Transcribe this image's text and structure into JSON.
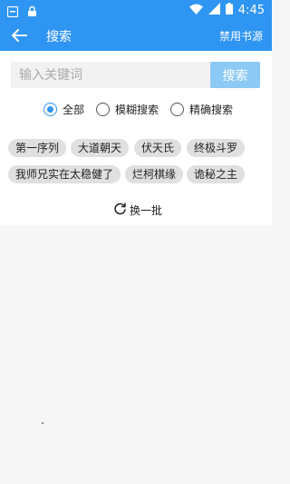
{
  "status_bar": {
    "time": "4:45",
    "icons": [
      "notification-icon",
      "lock-icon",
      "wifi-icon",
      "signal-icon",
      "battery-icon"
    ]
  },
  "app_bar": {
    "title": "搜索",
    "ban_label": "禁用书源",
    "back_icon": "back-arrow-icon"
  },
  "search": {
    "placeholder": "输入关键词",
    "value": "",
    "button_label": "搜索"
  },
  "filters": {
    "options": [
      "全部",
      "模糊搜索",
      "精确搜索"
    ],
    "selected": "全部"
  },
  "tags": [
    "第一序列",
    "大道朝天",
    "伏天氏",
    "终极斗罗",
    "我师兄实在太稳健了",
    "烂柯棋缘",
    "诡秘之主"
  ],
  "refresh_label": "换一批",
  "colors": {
    "primary": "#2f95f2",
    "search_button": "#8cc9f4",
    "tag_bg": "#e0e0e0",
    "page_bg": "#f6f6f6"
  }
}
